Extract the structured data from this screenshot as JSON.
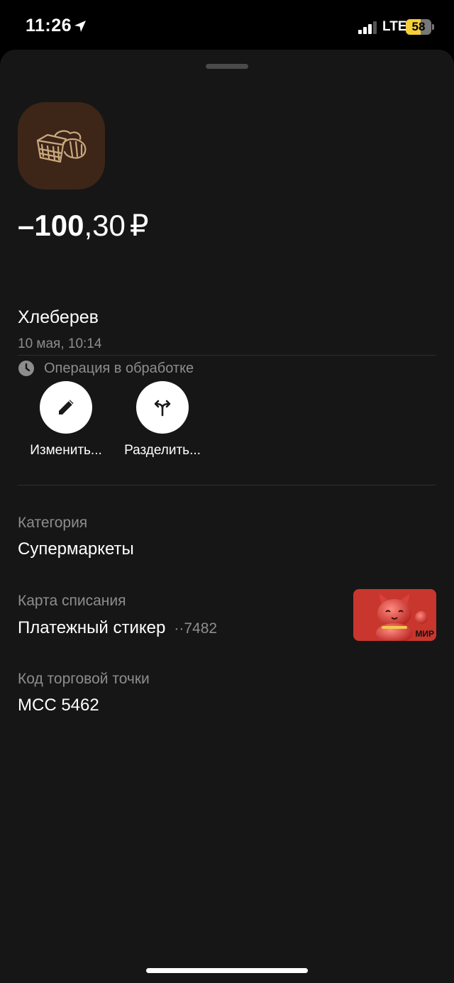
{
  "status_bar": {
    "time": "11:26",
    "network": "LTE",
    "battery_percent": "58",
    "battery_level": 0.58,
    "signal_bars_active": 3,
    "signal_bars_total": 4
  },
  "transaction": {
    "merchant_icon": "bread-basket-icon",
    "amount_integer": "–100",
    "amount_fraction": ",30",
    "currency": "₽",
    "merchant_name": "Хлеберев",
    "datetime": "10 мая, 10:14",
    "status": "Операция в обработке",
    "status_icon": "clock-icon"
  },
  "actions": [
    {
      "label": "Изменить...",
      "icon": "pencil-icon"
    },
    {
      "label": "Разделить...",
      "icon": "split-arrows-icon"
    }
  ],
  "details": {
    "category_label": "Категория",
    "category_value": "Супермаркеты",
    "card_label": "Карта списания",
    "card_value": "Платежный стикер",
    "card_mask": "··7482",
    "card_image": "lucky-cat-card-icon",
    "card_brand": "МИР",
    "mcc_label": "Код торговой точки",
    "mcc_value": "MCC 5462"
  },
  "colors": {
    "background": "#000000",
    "sheet": "#161616",
    "muted_text": "#8d8d8d",
    "logo_bg": "#3d2518",
    "battery_yellow": "#f5cf3a",
    "card_red": "#c8362e"
  }
}
